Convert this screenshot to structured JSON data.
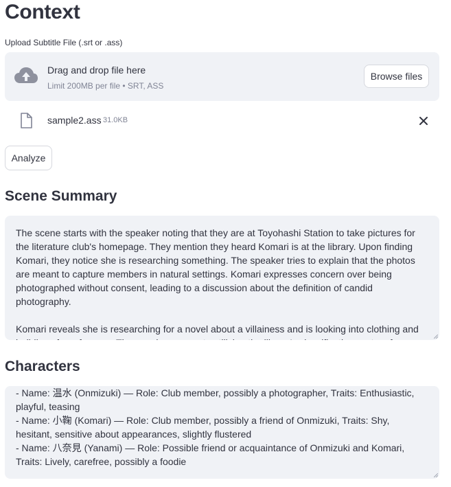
{
  "page": {
    "title": "Context"
  },
  "upload": {
    "label": "Upload Subtitle File (.srt or .ass)",
    "primary_text": "Drag and drop file here",
    "secondary_text": "Limit 200MB per file • SRT, ASS",
    "browse_label": "Browse files",
    "icon": "cloud-upload-icon"
  },
  "uploaded_file": {
    "name": "sample2.ass",
    "size": "31.0KB",
    "icon": "file-icon",
    "remove_icon": "close-icon"
  },
  "analyze_button": "Analyze",
  "scene_summary": {
    "heading": "Scene Summary",
    "text": "The scene starts with the speaker noting that they are at Toyohashi Station to take pictures for the literature club's homepage. They mention they heard Komari is at the library. Upon finding Komari, they notice she is researching something. The speaker tries to explain that the photos are meant to capture members in natural settings. Komari expresses concern over being photographed without consent, leading to a discussion about the definition of candid photography.\n\nKomari reveals she is researching for a novel about a villainess and is looking into clothing and buildings for reference. The speaker suggests utilizing the library's classification system for research"
  },
  "characters": {
    "heading": "Characters",
    "text": "- Name: 温水 (Onmizuki) — Role: Club member, possibly a photographer, Traits: Enthusiastic, playful, teasing\n- Name: 小鞠 (Komari) — Role: Club member, possibly a friend of Onmizuki, Traits: Shy, hesitant, sensitive about appearances, slightly flustered\n- Name: 八奈見 (Yanami) — Role: Possible friend or acquaintance of Onmizuki and Komari, Traits: Lively, carefree, possibly a foodie"
  }
}
